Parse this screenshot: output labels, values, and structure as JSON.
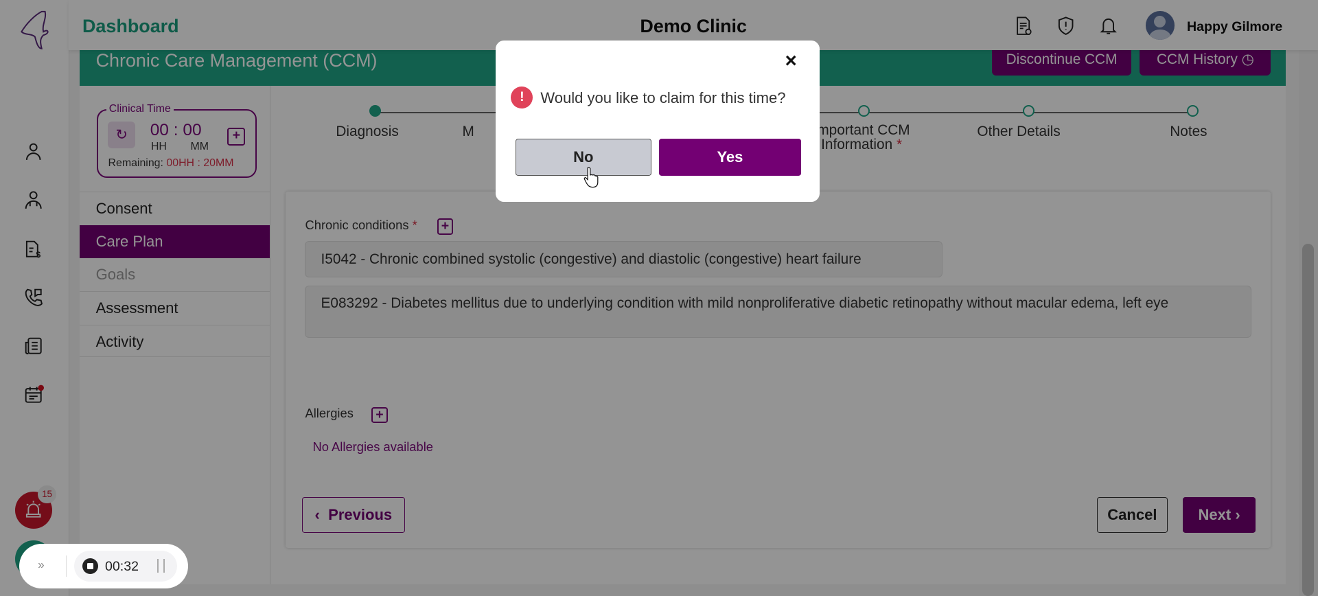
{
  "header": {
    "title": "Dashboard",
    "clinic": "Demo Clinic",
    "user_name": "Happy Gilmore"
  },
  "banner": {
    "title": "Chronic Care Management (CCM)",
    "discontinue": "Discontinue CCM",
    "history": "CCM History"
  },
  "clinical_time": {
    "label": "Clinical Time",
    "hh": "00",
    "mm": "00",
    "sep": ":",
    "hh_label": "HH",
    "mm_label": "MM",
    "remaining_label": "Remaining:",
    "remaining_value": "00HH : 20MM"
  },
  "menu": [
    {
      "label": "Consent"
    },
    {
      "label": "Care Plan"
    },
    {
      "label": "Goals"
    },
    {
      "label": "Assessment"
    },
    {
      "label": "Activity"
    }
  ],
  "steps": [
    {
      "label": "Diagnosis"
    },
    {
      "label": "M"
    },
    {
      "label": ""
    },
    {
      "label": "Important CCM Information",
      "required": "*"
    },
    {
      "label": "Other Details"
    },
    {
      "label": "Notes"
    }
  ],
  "form": {
    "chronic_label": "Chronic conditions",
    "required": "*",
    "conditions": [
      "I5042 - Chronic combined systolic (congestive) and diastolic (congestive) heart failure",
      "E083292 - Diabetes mellitus due to underlying condition with mild nonproliferative diabetic retinopathy without macular edema, left eye"
    ],
    "allergies_label": "Allergies",
    "no_allergies": "No Allergies available",
    "previous": "Previous",
    "cancel": "Cancel",
    "next": "Next"
  },
  "alerts": {
    "count": "15"
  },
  "modal": {
    "question": "Would you like to claim for this time?",
    "no": "No",
    "yes": "Yes",
    "close": "×"
  },
  "recorder": {
    "time": "00:32"
  },
  "colors": {
    "primary": "#730073",
    "accent": "#1fa687",
    "danger": "#e0435a"
  }
}
